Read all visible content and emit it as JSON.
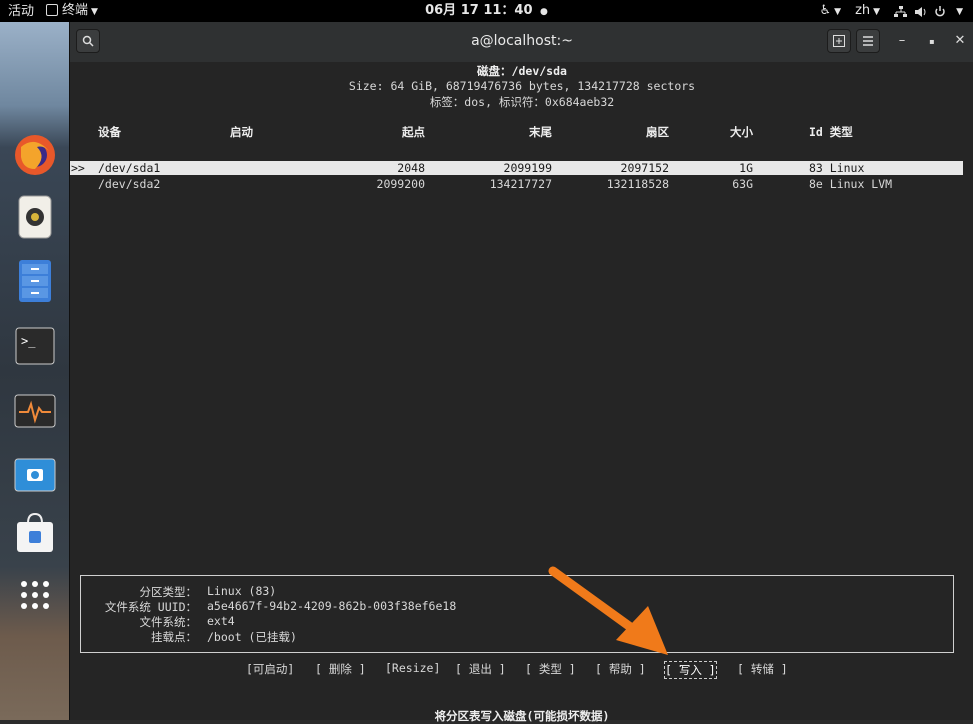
{
  "topbar": {
    "activities": "活动",
    "app_name": "终端",
    "clock": "06月 17  11：40",
    "input_method": "zh"
  },
  "window": {
    "title": "a@localhost:~"
  },
  "cfdisk": {
    "disk_line": "磁盘：/dev/sda",
    "size_line": "Size: 64 GiB, 68719476736 bytes, 134217728 sectors",
    "label_line": "标签：dos, 标识符：0x684aeb32",
    "columns": {
      "device": "设备",
      "boot": "启动",
      "start": "起点",
      "end": "末尾",
      "sectors": "扇区",
      "size": "大小",
      "id_type": "Id 类型"
    },
    "rows": [
      {
        "marker": ">>",
        "device": "/dev/sda1",
        "start": "2048",
        "end": "2099199",
        "sectors": "2097152",
        "size": "1G",
        "id_type": "83 Linux"
      },
      {
        "marker": "",
        "device": "/dev/sda2",
        "start": "2099200",
        "end": "134217727",
        "sectors": "132118528",
        "size": "63G",
        "id_type": "8e Linux LVM"
      }
    ],
    "info": {
      "ptype_label": "分区类型：",
      "ptype_value": "Linux (83)",
      "fsuuid_label": "文件系统 UUID：",
      "fsuuid_value": "a5e4667f-94b2-4209-862b-003f38ef6e18",
      "fs_label": "文件系统：",
      "fs_value": "ext4",
      "mount_label": "挂载点：",
      "mount_value": "/boot (已挂载)"
    },
    "menu": {
      "bootable": "[可启动]",
      "delete": "[ 删除 ]",
      "resize": "[Resize]",
      "quit": "[ 退出 ]",
      "type": "[ 类型 ]",
      "help": "[ 帮助 ]",
      "write": "[ 写入 ]",
      "dump": "[ 转储 ]"
    },
    "hint": "将分区表写入磁盘(可能损坏数据)"
  },
  "colors": {
    "arrow": "#f07a1a",
    "selected_row_bg": "#e8e8e8",
    "terminal_bg": "#252525"
  }
}
